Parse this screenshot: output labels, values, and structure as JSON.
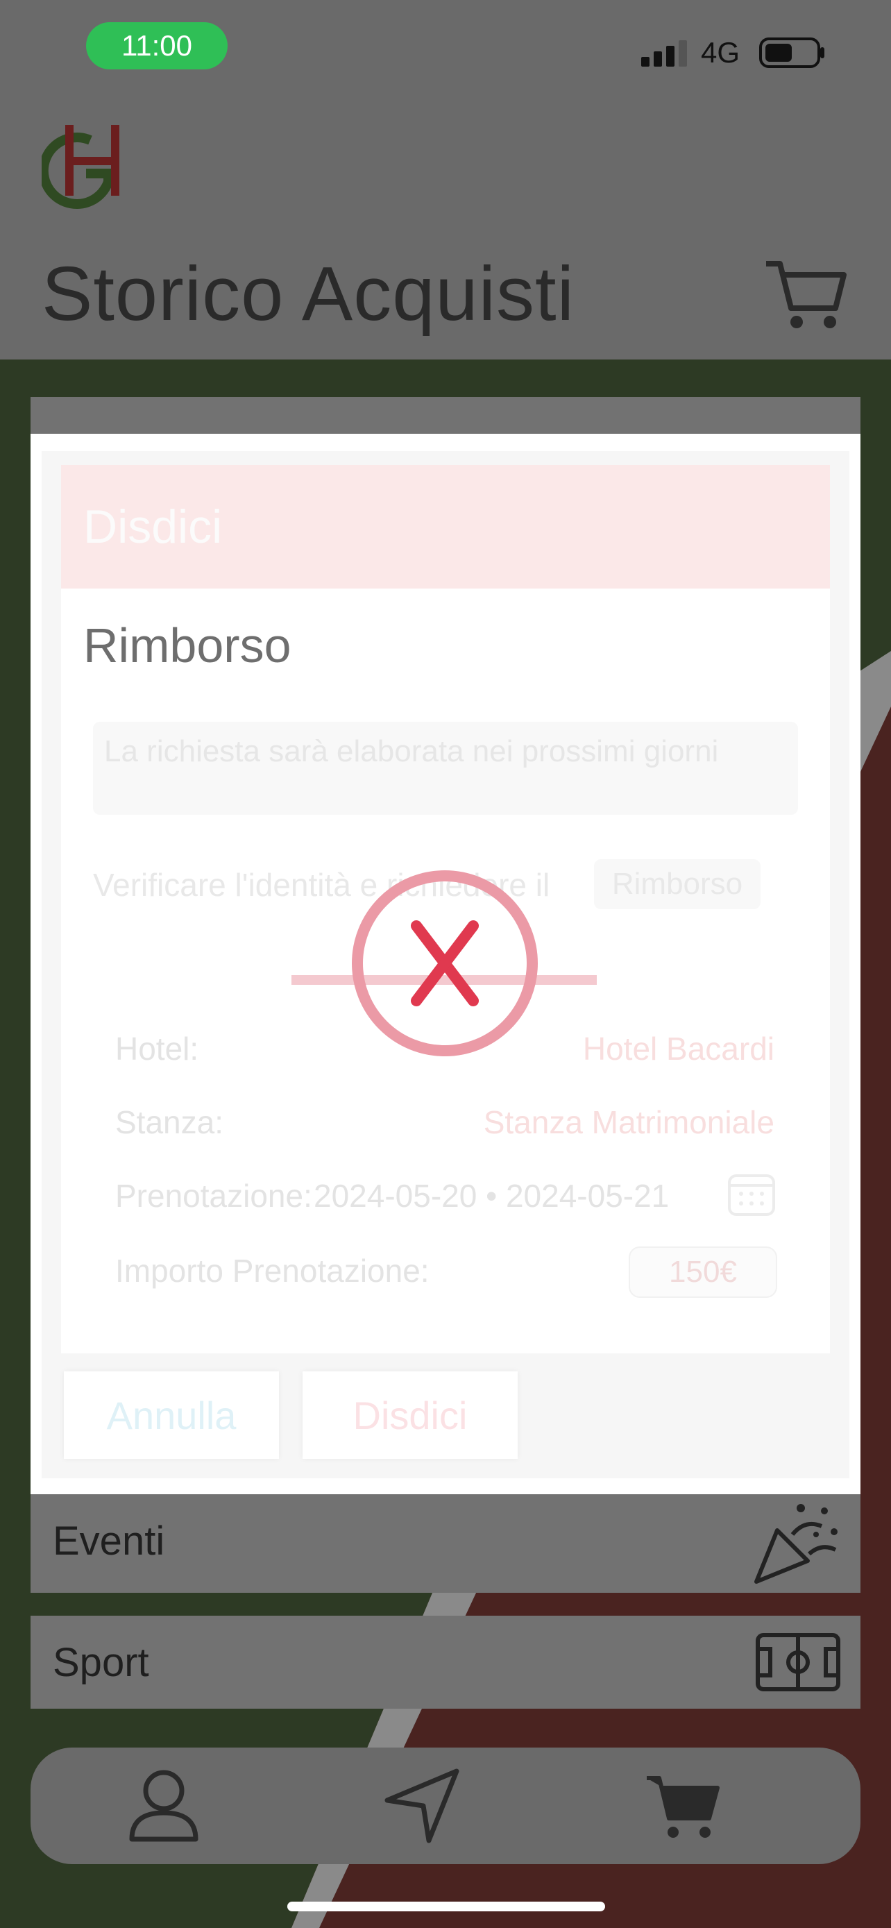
{
  "status_bar": {
    "time": "11:00",
    "network": "4G"
  },
  "header": {
    "logo_alt": "GH",
    "title": "Storico Acquisti",
    "cart_icon": "cart-icon"
  },
  "modal": {
    "header_title": "Disdici",
    "section_title": "Rimborso",
    "note": "La richiesta sarà elaborata nei prossimi giorni",
    "verify_text": "Verificare l'identità e richiedere il",
    "verify_chip": "Rimborso",
    "rows": [
      {
        "label": "Hotel:",
        "value": "Hotel Bacardi"
      },
      {
        "label": "Stanza:",
        "value": "Stanza Matrimoniale"
      },
      {
        "label": "Prenotazione:",
        "value": "2024-05-20 • 2024-05-21"
      },
      {
        "label": "Importo Prenotazione:",
        "value": "150€"
      }
    ],
    "cancel_label": "Annulla",
    "confirm_label": "Disdici",
    "error_icon": "error-x-icon"
  },
  "cards": [
    {
      "label": "Eventi",
      "icon": "party-popper-icon"
    },
    {
      "label": "Sport",
      "icon": "field-icon"
    }
  ],
  "tab_bar": {
    "items": [
      {
        "icon": "user-icon"
      },
      {
        "icon": "navigation-icon"
      },
      {
        "icon": "cart-icon"
      }
    ]
  },
  "colors": {
    "status_pill": "#2fbf56",
    "overlay": "#6a6a6a",
    "error_red": "#e0394f",
    "flag_green": "#2d3a24",
    "flag_red": "#4a2320"
  }
}
